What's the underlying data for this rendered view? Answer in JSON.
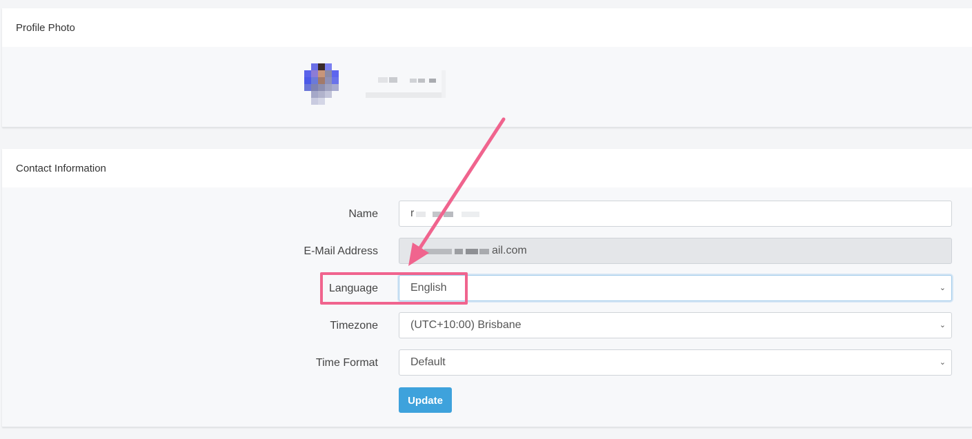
{
  "profile_photo": {
    "header": "Profile Photo"
  },
  "contact": {
    "header": "Contact Information",
    "name": {
      "label": "Name",
      "value": "r"
    },
    "email": {
      "label": "E-Mail Address",
      "value_visible": "ail.com"
    },
    "language": {
      "label": "Language",
      "selected": "English"
    },
    "timezone": {
      "label": "Timezone",
      "selected": "(UTC+10:00) Brisbane"
    },
    "time_format": {
      "label": "Time Format",
      "selected": "Default"
    },
    "update_label": "Update"
  },
  "icons": {
    "select_chevron": "chevron-down-icon",
    "annotation": "arrow-icon"
  },
  "colors": {
    "accent_button": "#3ea2dc",
    "annotation_pink": "#f0648e"
  }
}
